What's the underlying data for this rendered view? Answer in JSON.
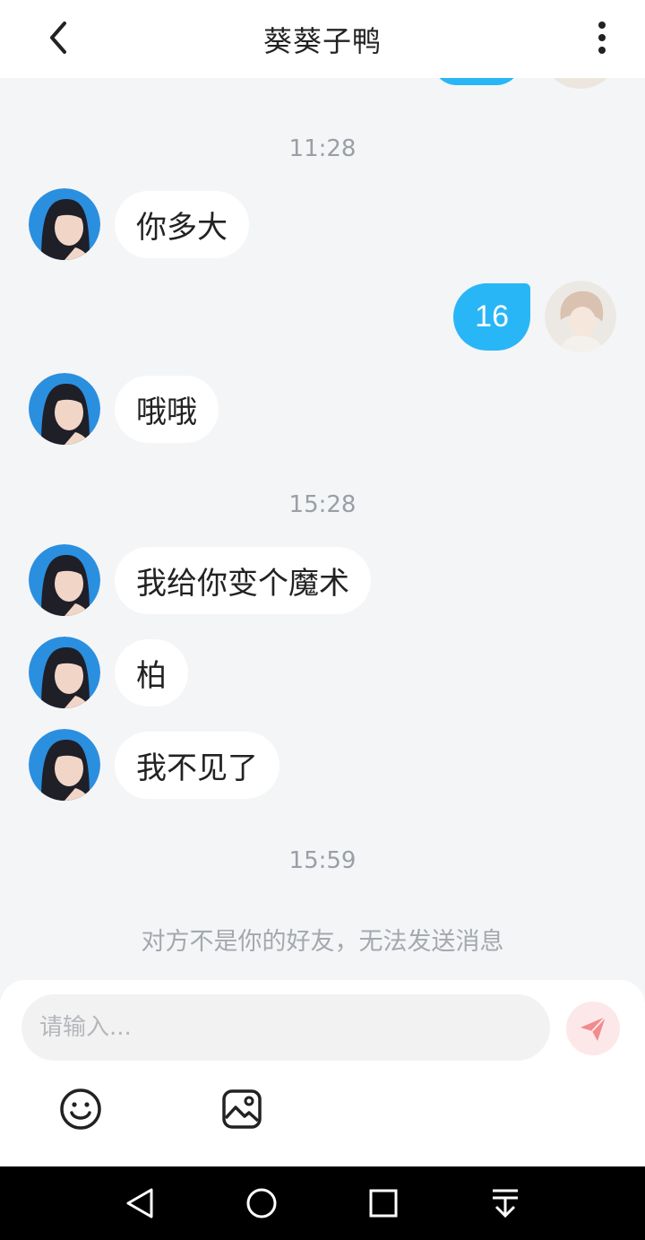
{
  "header": {
    "title": "葵葵子鸭"
  },
  "messages": [
    {
      "timestamp": "11:28"
    },
    {
      "side": "left",
      "text": "你多大"
    },
    {
      "side": "right",
      "text": "16"
    },
    {
      "side": "left",
      "text": "哦哦"
    },
    {
      "timestamp": "15:28"
    },
    {
      "side": "left",
      "text": "我给你变个魔术"
    },
    {
      "side": "left",
      "text": "柏"
    },
    {
      "side": "left",
      "text": "我不见了"
    },
    {
      "timestamp": "15:59"
    }
  ],
  "ts1": "11:28",
  "ts2": "15:28",
  "ts3": "15:59",
  "msg1": "你多大",
  "msg2": "16",
  "msg3": "哦哦",
  "msg4": "我给你变个魔术",
  "msg5": "柏",
  "msg6": "我不见了",
  "notice": "对方不是你的好友，无法发送消息",
  "input": {
    "placeholder": "请输入...",
    "value": ""
  },
  "icons": {
    "back": "back-arrow-icon",
    "more": "more-vertical-icon",
    "send": "send-paper-plane-icon",
    "emoji": "emoji-smile-icon",
    "image": "image-icon",
    "nav_back": "nav-back-icon",
    "nav_home": "nav-home-icon",
    "nav_recent": "nav-recent-icon",
    "nav_menu": "nav-dropdown-icon"
  },
  "colors": {
    "accent": "#29b6f6",
    "send_bg": "#fde8e9",
    "send_icon": "#f28b8e"
  }
}
